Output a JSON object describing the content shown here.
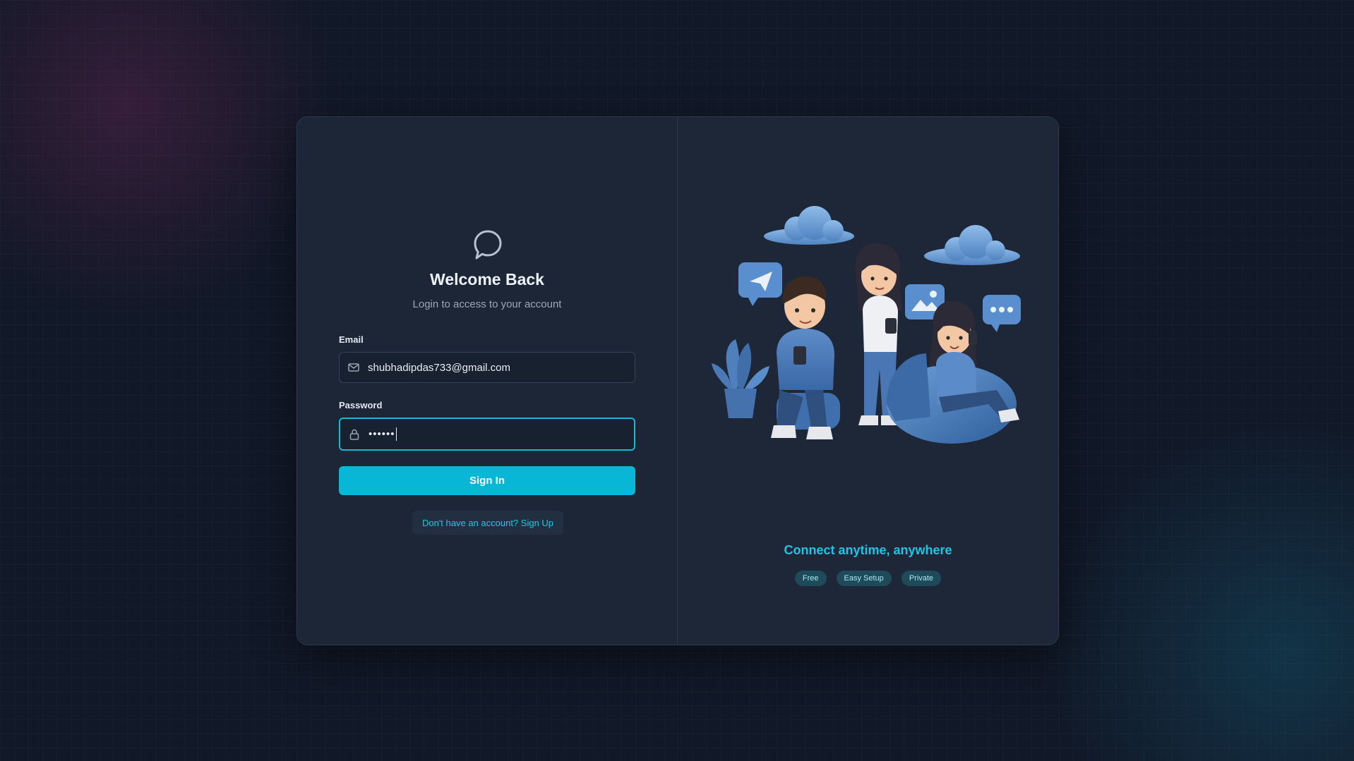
{
  "login": {
    "title": "Welcome Back",
    "subtitle": "Login to access to your account",
    "email_label": "Email",
    "email_value": "shubhadipdas733@gmail.com",
    "password_label": "Password",
    "password_value": "••••••",
    "signin_label": "Sign In",
    "signup_link": "Don't have an account? Sign Up"
  },
  "promo": {
    "tagline": "Connect anytime, anywhere",
    "badges": [
      "Free",
      "Easy Setup",
      "Private"
    ]
  },
  "icons": {
    "logo": "chat-bubble-icon",
    "email": "mail-icon",
    "password": "lock-icon"
  },
  "colors": {
    "accent": "#08b6d6",
    "background": "#111827",
    "card": "#1c2637"
  }
}
